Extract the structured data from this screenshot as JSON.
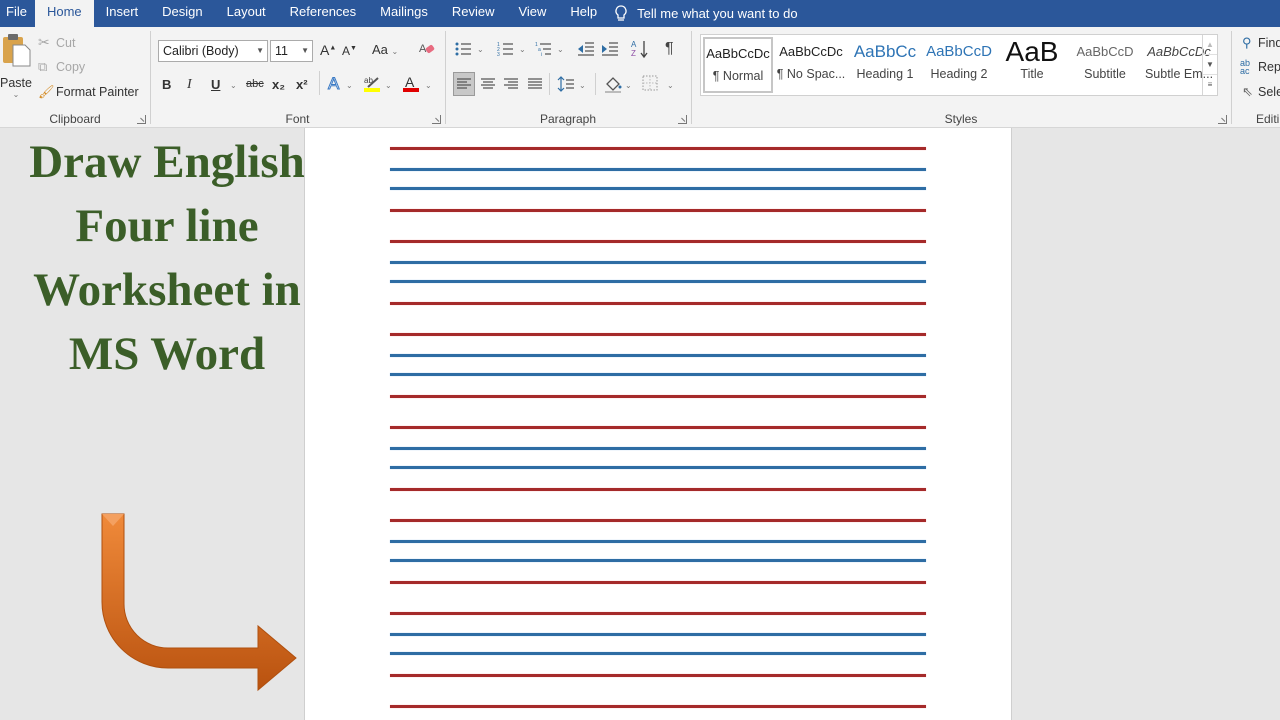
{
  "titlebar": {
    "tabs": [
      "File",
      "Home",
      "Insert",
      "Design",
      "Layout",
      "References",
      "Mailings",
      "Review",
      "View",
      "Help"
    ],
    "active_tab": "Home",
    "tell_me": "Tell me what you want to do"
  },
  "ribbon": {
    "clipboard": {
      "label": "Clipboard",
      "paste": "Paste",
      "cut": "Cut",
      "copy": "Copy",
      "format_painter": "Format Painter"
    },
    "font": {
      "label": "Font",
      "font_name": "Calibri (Body)",
      "font_size": "11",
      "change_case": "Aa",
      "bold": "B",
      "italic": "I",
      "underline": "U",
      "strikethrough": "abc",
      "subscript": "x₂",
      "superscript": "x²",
      "highlight_color": "#ffff00",
      "font_color": "#e00000"
    },
    "paragraph": {
      "label": "Paragraph",
      "pilcrow": "¶"
    },
    "styles": {
      "label": "Styles",
      "items": [
        {
          "sample": "AaBbCcDc",
          "name": "¶ Normal",
          "selected": true
        },
        {
          "sample": "AaBbCcDc",
          "name": "¶ No Spac..."
        },
        {
          "sample": "AaBbCc",
          "name": "Heading 1"
        },
        {
          "sample": "AaBbCcD",
          "name": "Heading 2"
        },
        {
          "sample": "AaB",
          "name": "Title"
        },
        {
          "sample": "AaBbCcD",
          "name": "Subtitle"
        },
        {
          "sample": "AaBbCcDc",
          "name": "Subtle Em..."
        }
      ]
    },
    "editing": {
      "label": "Editing",
      "find": "Find",
      "replace": "Replace",
      "select": "Select"
    }
  },
  "overlay": {
    "headline_lines": [
      "Draw English",
      "Four line",
      "Worksheet in",
      "MS Word"
    ],
    "headline_color": "#3b5e28",
    "arrow_color": "#e0701e"
  },
  "document": {
    "worksheet": {
      "line_sets": 7,
      "line_pattern": [
        "red",
        "blue",
        "blue",
        "red"
      ],
      "colors": {
        "red": "#a52a2a",
        "blue": "#2e6da4"
      }
    }
  }
}
